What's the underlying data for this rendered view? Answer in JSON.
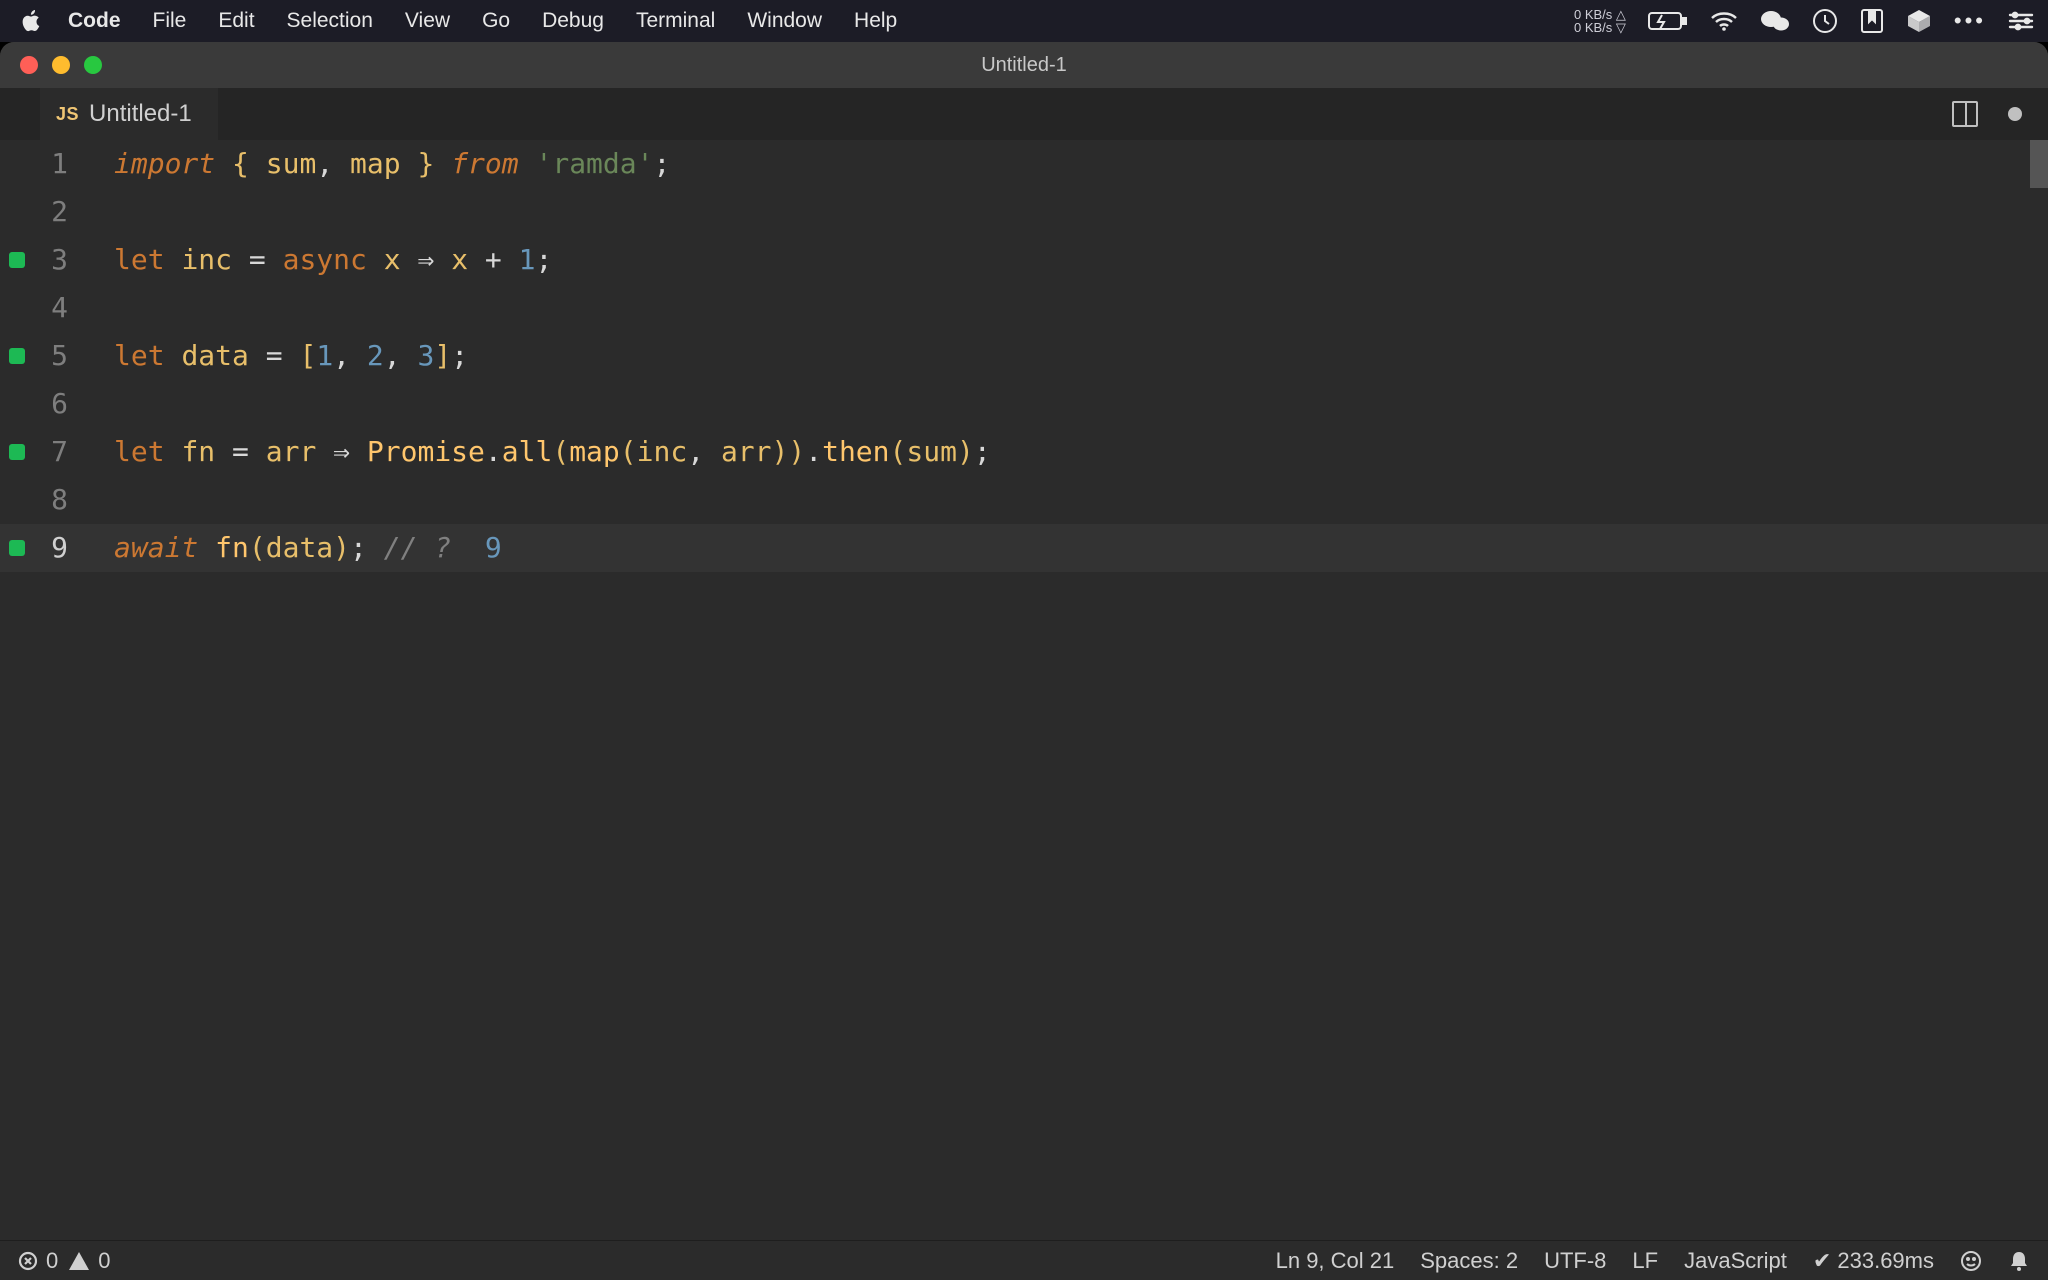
{
  "menubar": {
    "app": "Code",
    "items": [
      "File",
      "Edit",
      "Selection",
      "View",
      "Go",
      "Debug",
      "Terminal",
      "Window",
      "Help"
    ],
    "net_up": "0 KB/s",
    "net_down": "0 KB/s"
  },
  "window": {
    "title": "Untitled-1"
  },
  "tab": {
    "lang_badge": "JS",
    "name": "Untitled-1"
  },
  "editor": {
    "lines": [
      {
        "n": 1,
        "marker": false,
        "active": false,
        "tokens": [
          [
            "kw",
            "import"
          ],
          [
            "wt",
            " "
          ],
          [
            "br",
            "{"
          ],
          [
            "wt",
            " "
          ],
          [
            "id",
            "sum"
          ],
          [
            "wt",
            ", "
          ],
          [
            "id",
            "map"
          ],
          [
            "wt",
            " "
          ],
          [
            "br",
            "}"
          ],
          [
            "wt",
            " "
          ],
          [
            "kw",
            "from"
          ],
          [
            "wt",
            " "
          ],
          [
            "str",
            "'ramda'"
          ],
          [
            "wt",
            ";"
          ]
        ]
      },
      {
        "n": 2,
        "marker": false,
        "active": false,
        "tokens": []
      },
      {
        "n": 3,
        "marker": true,
        "active": false,
        "tokens": [
          [
            "kw2",
            "let"
          ],
          [
            "wt",
            " "
          ],
          [
            "id",
            "inc"
          ],
          [
            "wt",
            " = "
          ],
          [
            "kw2",
            "async"
          ],
          [
            "wt",
            " "
          ],
          [
            "id",
            "x"
          ],
          [
            "wt",
            " ⇒ "
          ],
          [
            "id",
            "x"
          ],
          [
            "wt",
            " + "
          ],
          [
            "num",
            "1"
          ],
          [
            "wt",
            ";"
          ]
        ]
      },
      {
        "n": 4,
        "marker": false,
        "active": false,
        "tokens": []
      },
      {
        "n": 5,
        "marker": true,
        "active": false,
        "tokens": [
          [
            "kw2",
            "let"
          ],
          [
            "wt",
            " "
          ],
          [
            "id",
            "data"
          ],
          [
            "wt",
            " = "
          ],
          [
            "br",
            "["
          ],
          [
            "num",
            "1"
          ],
          [
            "wt",
            ", "
          ],
          [
            "num",
            "2"
          ],
          [
            "wt",
            ", "
          ],
          [
            "num",
            "3"
          ],
          [
            "br",
            "]"
          ],
          [
            "wt",
            ";"
          ]
        ]
      },
      {
        "n": 6,
        "marker": false,
        "active": false,
        "tokens": []
      },
      {
        "n": 7,
        "marker": true,
        "active": false,
        "tokens": [
          [
            "kw2",
            "let"
          ],
          [
            "wt",
            " "
          ],
          [
            "id",
            "fn"
          ],
          [
            "wt",
            " = "
          ],
          [
            "id",
            "arr"
          ],
          [
            "wt",
            " ⇒ "
          ],
          [
            "fn",
            "Promise"
          ],
          [
            "wt",
            "."
          ],
          [
            "fn",
            "all"
          ],
          [
            "br",
            "("
          ],
          [
            "fn",
            "map"
          ],
          [
            "br",
            "("
          ],
          [
            "id",
            "inc"
          ],
          [
            "wt",
            ", "
          ],
          [
            "id",
            "arr"
          ],
          [
            "br",
            ")"
          ],
          [
            "br",
            ")"
          ],
          [
            "wt",
            "."
          ],
          [
            "fn",
            "then"
          ],
          [
            "br",
            "("
          ],
          [
            "id",
            "sum"
          ],
          [
            "br",
            ")"
          ],
          [
            "wt",
            ";"
          ]
        ]
      },
      {
        "n": 8,
        "marker": false,
        "active": false,
        "tokens": []
      },
      {
        "n": 9,
        "marker": true,
        "active": true,
        "tokens": [
          [
            "kw",
            "await"
          ],
          [
            "wt",
            " "
          ],
          [
            "fn",
            "fn"
          ],
          [
            "br",
            "("
          ],
          [
            "id",
            "data"
          ],
          [
            "br",
            ")"
          ],
          [
            "wt",
            "; "
          ],
          [
            "cmt",
            "// ?"
          ],
          [
            "wt",
            "  "
          ],
          [
            "num",
            "9"
          ]
        ]
      }
    ]
  },
  "status": {
    "errors": "0",
    "warnings": "0",
    "cursor": "Ln 9, Col 21",
    "spaces": "Spaces: 2",
    "encoding": "UTF-8",
    "eol": "LF",
    "language": "JavaScript",
    "quokka": "✔ 233.69ms"
  }
}
